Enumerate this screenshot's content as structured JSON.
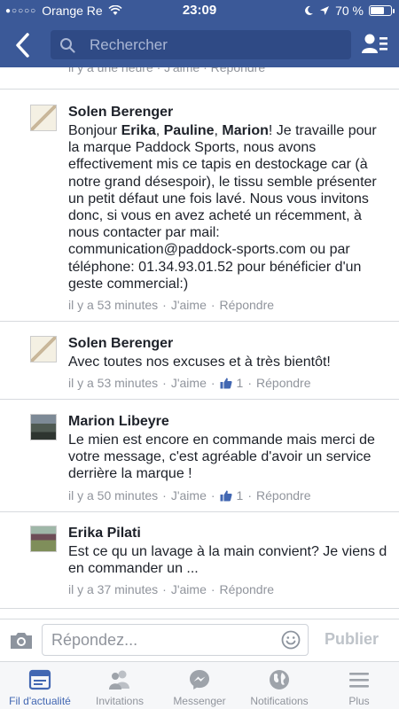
{
  "status_bar": {
    "carrier": "Orange Re",
    "time": "23:09",
    "battery": "70 %",
    "battery_level": 0.7
  },
  "header": {
    "search_placeholder": "Rechercher"
  },
  "feed": {
    "top_meta": "il y a une heure · J'aime · Répondre",
    "comments": [
      {
        "name": "Solen Berenger",
        "text_parts": [
          "Bonjour ",
          "Erika",
          ", ",
          "Pauline",
          ", ",
          "Marion",
          "! Je travaille pour la marque Paddock Sports, nous avons effectivement mis ce tapis en destockage car (à notre grand désespoir), le tissu semble présenter un petit défaut une fois lavé. Nous vous invitons donc, si vous en avez acheté un récemment, à nous contacter par mail: communication@paddock-sports.com ou par téléphone: 01.34.93.01.52 pour bénéficier d'un geste commercial:)"
        ],
        "time": "il y a 53 minutes",
        "like": "J'aime",
        "reply": "Répondre"
      },
      {
        "name": "Solen Berenger",
        "text": "Avec toutes nos excuses et à très bientôt!",
        "time": "il y a 53 minutes",
        "like": "J'aime",
        "like_count": "1",
        "reply": "Répondre"
      },
      {
        "name": "Marion Libeyre",
        "text": "Le mien est encore en commande mais merci de votre message, c'est agréable d'avoir un service derrière la marque !",
        "time": "il y a 50 minutes",
        "like": "J'aime",
        "like_count": "1",
        "reply": "Répondre"
      },
      {
        "name": "Erika Pilati",
        "text": "Est ce qu un lavage à la main convient?  Je viens d en commander un ...",
        "time": "il y a 37 minutes",
        "like": "J'aime",
        "reply": "Répondre"
      }
    ]
  },
  "compose": {
    "placeholder": "Répondez...",
    "publish_label": "Publier"
  },
  "tabbar": {
    "tabs": [
      {
        "label": "Fil d'actualité",
        "icon": "news-feed-icon",
        "active": true
      },
      {
        "label": "Invitations",
        "icon": "friend-requests-icon"
      },
      {
        "label": "Messenger",
        "icon": "messenger-icon"
      },
      {
        "label": "Notifications",
        "icon": "globe-icon"
      },
      {
        "label": "Plus",
        "icon": "menu-icon"
      }
    ]
  },
  "colors": {
    "brand": "#3b5998",
    "meta_text": "#90949c",
    "active_tab": "#4267b2"
  }
}
